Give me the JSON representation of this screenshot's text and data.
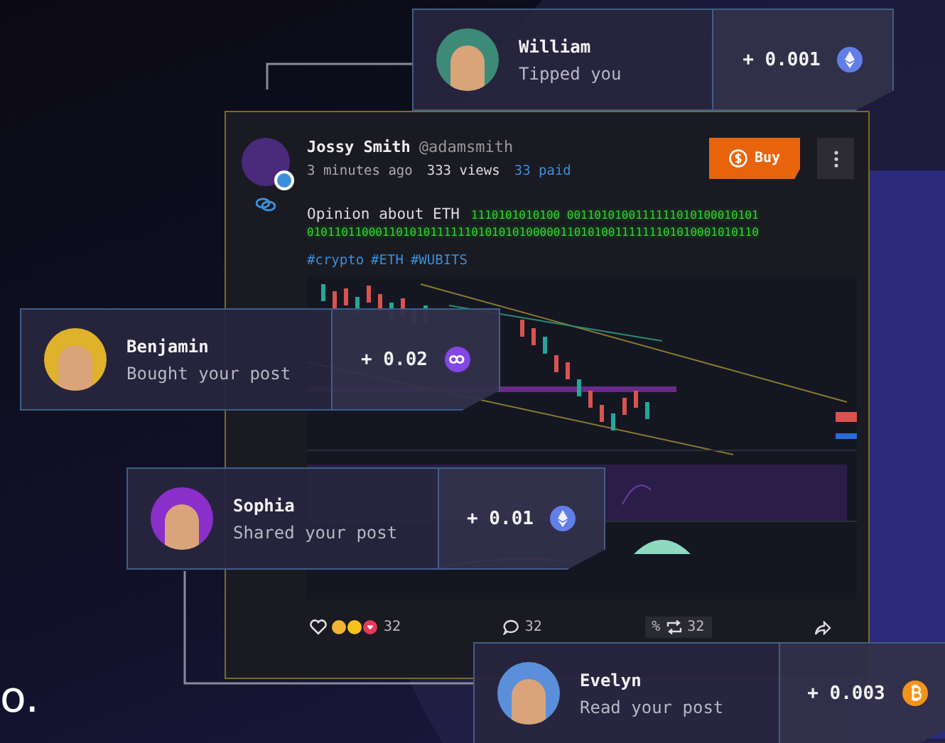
{
  "logo_text": "o.",
  "post": {
    "author": "Jossy Smith",
    "handle": "@adamsmith",
    "time": "3 minutes ago",
    "views": "333 views",
    "paid": "33 paid",
    "buy_label": "Buy",
    "text": "Opinion about ETH",
    "code_line_1": "1110101010100  0011010100111111010100010101",
    "code_line_2": "010110110001101010111111010101010000011010100111111101010001010110",
    "tags": [
      "#crypto",
      "#ETH",
      "#WUBITS"
    ],
    "reactions_count": "32",
    "comments_count": "32",
    "percent_label": "%",
    "reposts_count": "32"
  },
  "notifications": [
    {
      "name": "William",
      "action": "Tipped you",
      "amount": "+ 0.001",
      "kind": "eth",
      "color": "#3e8a78"
    },
    {
      "name": "Benjamin",
      "action": "Bought your post",
      "amount": "+ 0.02",
      "kind": "polygon",
      "color": "#e0b12a"
    },
    {
      "name": "Sophia",
      "action": "Shared your post",
      "amount": "+ 0.01",
      "kind": "eth",
      "color": "#8a2fc9"
    },
    {
      "name": "Evelyn",
      "action": "Read your post",
      "amount": "+ 0.003",
      "kind": "btc",
      "color": "#5b8fd9"
    }
  ]
}
